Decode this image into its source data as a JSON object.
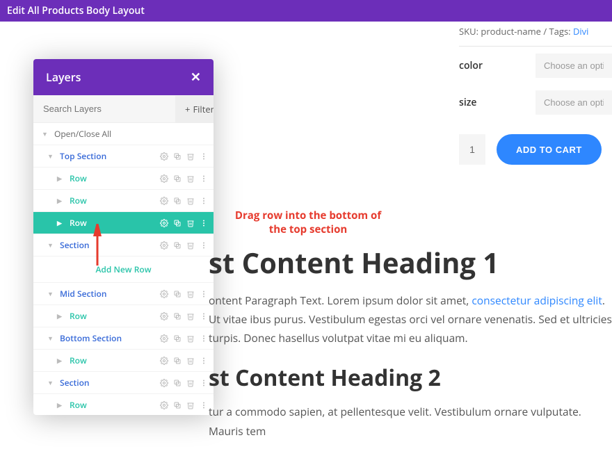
{
  "header": {
    "title": "Edit All Products Body Layout"
  },
  "product": {
    "sku_label": "SKU:",
    "sku_value": "product-name",
    "tags_label": "Tags:",
    "tags_link": "Divi",
    "options": [
      {
        "label": "color",
        "placeholder": "Choose an option"
      },
      {
        "label": "size",
        "placeholder": "Choose an option"
      }
    ],
    "qty": "1",
    "add_to_cart": "ADD TO CART"
  },
  "layers": {
    "title": "Layers",
    "search_placeholder": "Search Layers",
    "filter_label": "Filter",
    "open_close": "Open/Close All",
    "add_new_row": "Add New Row",
    "items": [
      {
        "type": "section",
        "label": "Top Section"
      },
      {
        "type": "row",
        "label": "Row"
      },
      {
        "type": "row",
        "label": "Row"
      },
      {
        "type": "row",
        "label": "Row",
        "active": true
      },
      {
        "type": "section",
        "label": "Section"
      },
      {
        "type": "addnew"
      },
      {
        "type": "section",
        "label": "Mid Section"
      },
      {
        "type": "row",
        "label": "Row"
      },
      {
        "type": "section",
        "label": "Bottom Section"
      },
      {
        "type": "row",
        "label": "Row"
      },
      {
        "type": "section",
        "label": "Section"
      },
      {
        "type": "row",
        "label": "Row"
      }
    ]
  },
  "annotation": "Drag row into the bottom of the top section",
  "content": {
    "h1": "st Content Heading 1",
    "p1a": "ontent Paragraph Text. Lorem ipsum dolor sit amet, ",
    "p1link": "consectetur adipiscing elit",
    "p1b": ". Ut vitae ibus purus. Vestibulum egestas orci vel ornare venenatis. Sed et ultricies turpis. Donec hasellus volutpat vitae mi eu aliquam.",
    "h2": "st Content Heading 2",
    "p2": "tur a commodo sapien, at pellentesque velit. Vestibulum ornare vulputate. Mauris tem"
  }
}
